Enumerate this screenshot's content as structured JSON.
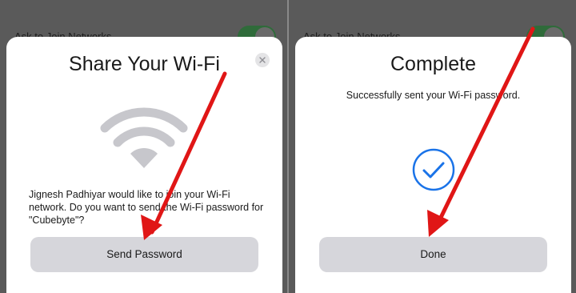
{
  "background": {
    "setting_label": "Ask to Join Networks"
  },
  "left_sheet": {
    "title": "Share Your Wi-Fi",
    "message": "Jignesh Padhiyar would like to join your Wi-Fi network. Do you want to send the Wi-Fi password for \"Cubebyte\"?",
    "button_label": "Send Password",
    "close_icon": "close-icon",
    "wifi_icon": "wifi-icon"
  },
  "right_sheet": {
    "title": "Complete",
    "status": "Successfully sent your Wi-Fi password.",
    "button_label": "Done",
    "check_icon": "checkmark-circle-icon"
  },
  "colors": {
    "accent_blue": "#1a73e8",
    "annotation_red": "#e01616",
    "button_gray": "#d6d6db",
    "wifi_gray": "#c7c7cc"
  }
}
